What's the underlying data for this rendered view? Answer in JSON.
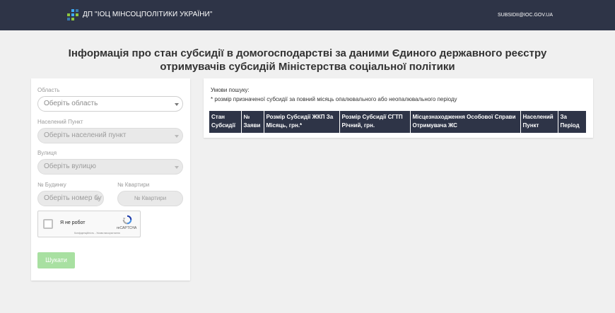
{
  "header": {
    "brand": "ДП \"ІОЦ МІНСОЦПОЛІТИКИ УКРАЇНИ\"",
    "email": "SUBSIDII@IOC.GOV.UA",
    "logo_icon": "pixel-grid-logo-icon",
    "colors": {
      "bar": "#2e3447",
      "logo_blue": "#3fa9f5",
      "logo_green": "#8cc63f"
    }
  },
  "page_title": {
    "line1": "Інформація про стан субсидії в домогосподарстві за даними Єдиного державного реєстру",
    "line2": "отримувачів субсидій Міністерства соціальної політики"
  },
  "form": {
    "region": {
      "label": "Область",
      "placeholder": "Оберіть область"
    },
    "locality": {
      "label": "Населений Пункт",
      "placeholder": "Оберіть населений пункт"
    },
    "street": {
      "label": "Вулиця",
      "placeholder": "Оберіть вулицю"
    },
    "house": {
      "label": "№ Будинку",
      "placeholder": "Оберіть номер бу"
    },
    "apartment": {
      "label": "№ Квартири",
      "placeholder": "№ Квартири"
    },
    "captcha": {
      "label": "Я не робот",
      "brand": "reCAPTCHA",
      "terms": "Конфіденційність - Умови використання"
    },
    "search_button": "Шукати",
    "colors": {
      "button": "#a8e0a1"
    }
  },
  "results": {
    "conditions_title": "Умови пошуку:",
    "note": "* розмір призначеної субсидії за повний місяць опалювального або неопалювального періоду",
    "columns": [
      "Стан Субсидії",
      "№ Заяви",
      "Розмір Субсидії ЖКП За Місяць, грн.*",
      "Розмір Субсидії СГТП Річний, грн.",
      "Місцезнаходження Особової Справи Отримувача ЖС",
      "Населений Пункт",
      "За Період"
    ]
  }
}
